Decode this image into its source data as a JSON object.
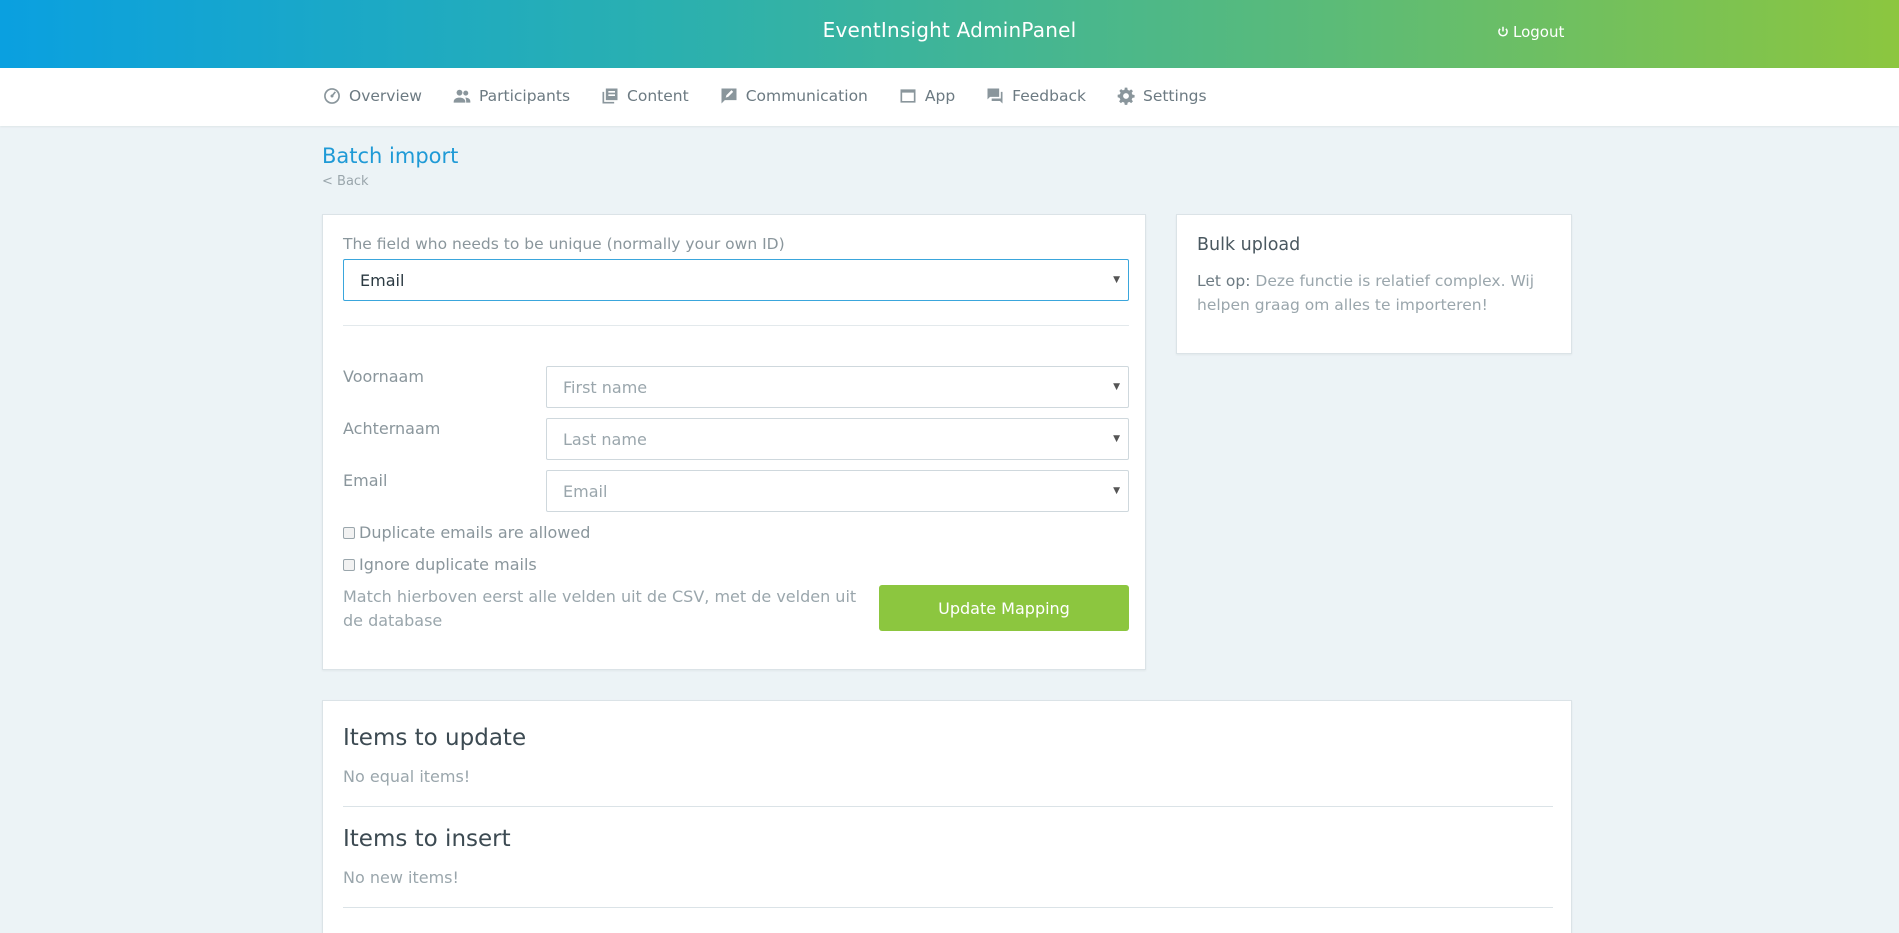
{
  "header": {
    "title": "EventInsight AdminPanel",
    "logout_label": "Logout"
  },
  "nav": {
    "items": [
      {
        "label": "Overview",
        "icon": "dashboard-icon"
      },
      {
        "label": "Participants",
        "icon": "people-icon"
      },
      {
        "label": "Content",
        "icon": "content-icon"
      },
      {
        "label": "Communication",
        "icon": "message-edit-icon"
      },
      {
        "label": "App",
        "icon": "app-window-icon"
      },
      {
        "label": "Feedback",
        "icon": "feedback-icon"
      },
      {
        "label": "Settings",
        "icon": "gear-icon"
      }
    ]
  },
  "page": {
    "title": "Batch import",
    "back_label": "< Back"
  },
  "form": {
    "unique_label": "The field who needs to be unique (normally your own ID)",
    "unique_value": "Email",
    "mappings": [
      {
        "label": "Voornaam",
        "value": "First name"
      },
      {
        "label": "Achternaam",
        "value": "Last name"
      },
      {
        "label": "Email",
        "value": "Email"
      }
    ],
    "checkbox_duplicates_allowed": "Duplicate emails are allowed",
    "checkbox_ignore_duplicates": "Ignore duplicate mails",
    "hint": "Match hierboven eerst alle velden uit de CSV, met de velden uit de database",
    "update_button": "Update Mapping"
  },
  "side": {
    "title": "Bulk upload",
    "note_prefix": "Let op:",
    "note_text": " Deze functie is relatief complex. Wij helpen graag om alles te importeren!"
  },
  "items": {
    "update_title": "Items to update",
    "update_text": "No equal items!",
    "insert_title": "Items to insert",
    "insert_text": "No new items!"
  },
  "colors": {
    "accent_blue": "#1f9ad6",
    "accent_green": "#8cc63f"
  }
}
